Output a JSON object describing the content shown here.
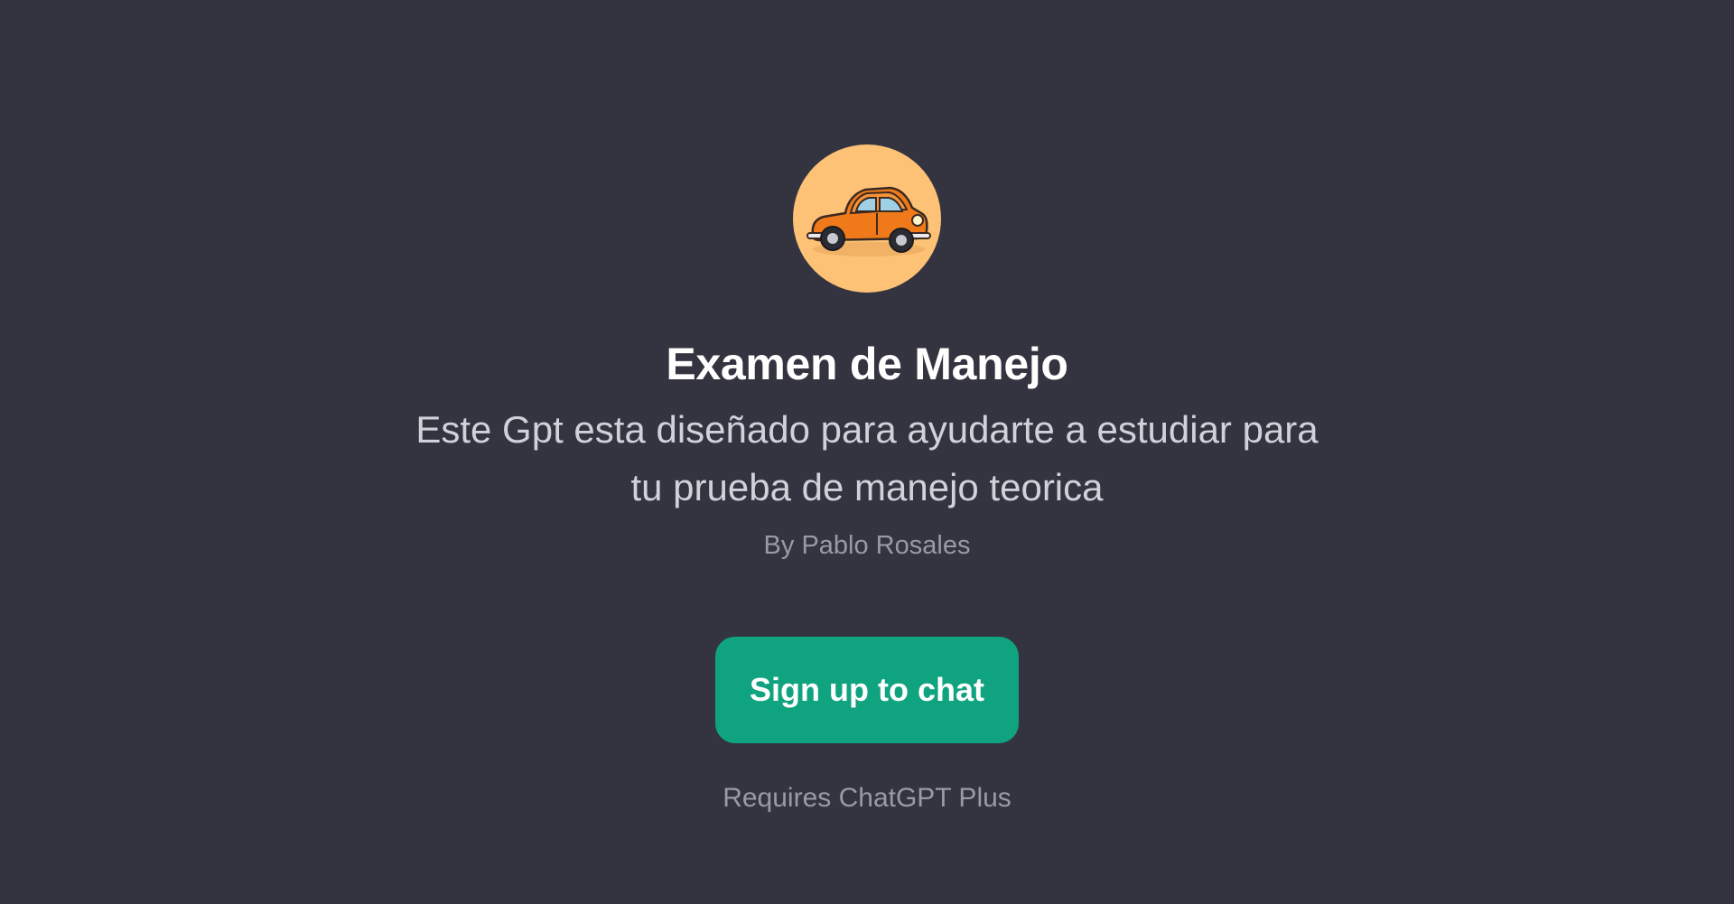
{
  "gpt": {
    "avatar_icon": "orange-vintage-car-icon",
    "title": "Examen de Manejo",
    "description": "Este Gpt esta diseñado para ayudarte a estudiar para tu prueba de manejo teorica",
    "author": "By Pablo Rosales"
  },
  "cta": {
    "label": "Sign up to chat"
  },
  "footer": {
    "requirement": "Requires ChatGPT Plus"
  },
  "colors": {
    "background": "#343440",
    "accent": "#10a37f",
    "avatar_background": "#fdc275"
  }
}
